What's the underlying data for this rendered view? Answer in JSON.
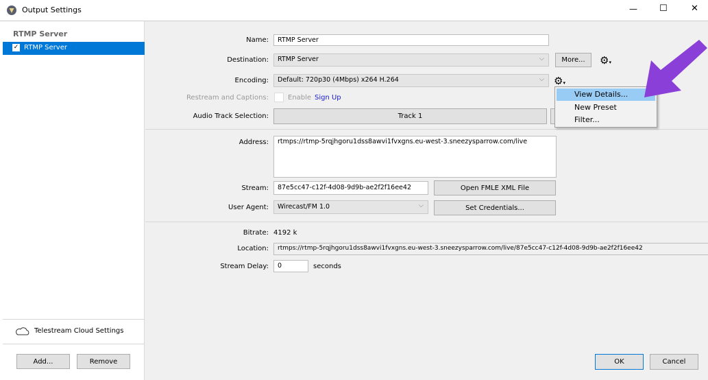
{
  "window": {
    "title": "Output Settings",
    "minimize": "—",
    "maximize": "☐",
    "close": "✕"
  },
  "sidebar": {
    "header": "RTMP Server",
    "items": [
      {
        "label": "RTMP Server",
        "checked": true,
        "selected": true
      }
    ],
    "cloud_label": "Telestream Cloud Settings",
    "add_label": "Add...",
    "remove_label": "Remove"
  },
  "form": {
    "name_label": "Name:",
    "name_value": "RTMP Server",
    "destination_label": "Destination:",
    "destination_value": "RTMP Server",
    "more_label": "More...",
    "encoding_label": "Encoding:",
    "encoding_value": "Default: 720p30 (4Mbps) x264 H.264",
    "restream_label": "Restream and Captions:",
    "enable_label": "Enable",
    "signup_label": "Sign Up",
    "audio_label": "Audio Track Selection:",
    "track_label": "Track 1",
    "address_label": "Address:",
    "address_value": "rtmps://rtmp-5rqjhgoru1dss8awvi1fvxgns.eu-west-3.sneezysparrow.com/live",
    "stream_label": "Stream:",
    "stream_value": "87e5cc47-c12f-4d08-9d9b-ae2f2f16ee42",
    "fmle_label": "Open FMLE XML File",
    "useragent_label": "User Agent:",
    "useragent_value": "Wirecast/FM 1.0",
    "credentials_label": "Set Credentials...",
    "bitrate_label": "Bitrate:",
    "bitrate_value": "4192 k",
    "location_label": "Location:",
    "location_value": "rtmps://rtmp-5rqjhgoru1dss8awvi1fvxgns.eu-west-3.sneezysparrow.com/live/87e5cc47-c12f-4d08-9d9b-ae2f2f16ee42",
    "delay_label": "Stream Delay:",
    "delay_value": "0",
    "delay_unit": "seconds"
  },
  "menu": {
    "items": [
      "View Details...",
      "New Preset",
      "Filter..."
    ],
    "highlighted": 0
  },
  "footer": {
    "ok_label": "OK",
    "cancel_label": "Cancel"
  },
  "colors": {
    "selection": "#0078d7",
    "menu_highlight": "#99ccf5",
    "arrow": "#8a3fd8",
    "link": "#1a1acc"
  }
}
